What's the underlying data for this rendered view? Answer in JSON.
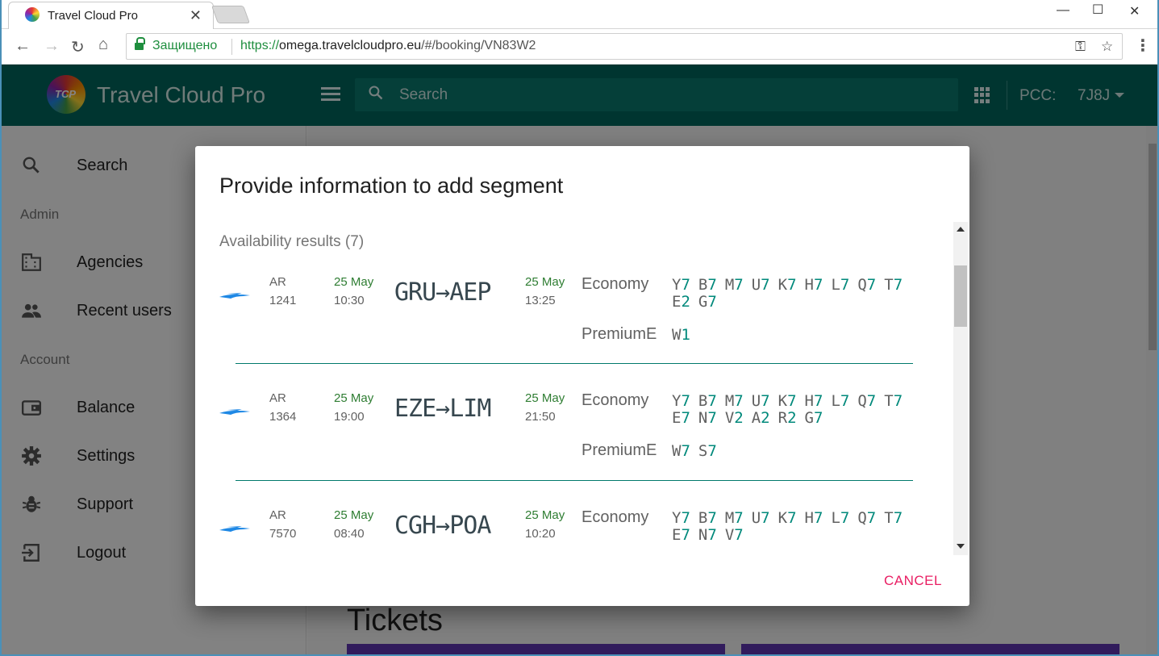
{
  "browser": {
    "tab_title": "Travel Cloud Pro",
    "secure_label": "Защищено",
    "url_scheme": "https://",
    "url_host": "omega.travelcloudpro.eu",
    "url_path": "/#/booking/VN83W2"
  },
  "appbar": {
    "brand": "Travel Cloud Pro",
    "logo_text": "TCP",
    "search_placeholder": "Search",
    "pcc_label": "PCC:",
    "pcc_value": "7J8J"
  },
  "sidebar": {
    "search": "Search",
    "admin_header": "Admin",
    "agencies": "Agencies",
    "recent_users": "Recent users",
    "account_header": "Account",
    "balance": "Balance",
    "settings": "Settings",
    "support": "Support",
    "logout": "Logout"
  },
  "main": {
    "tickets_heading": "Tickets"
  },
  "dialog": {
    "title": "Provide information to add segment",
    "results_heading": "Availability results (7)",
    "cancel_label": "CANCEL",
    "segments": [
      {
        "carrier": "AR",
        "flight": "1241",
        "dep_date": "25 May",
        "dep_time": "10:30",
        "route": "GRU→AEP",
        "arr_date": "25 May",
        "arr_time": "13:25",
        "cabins": [
          {
            "name": "Economy",
            "classes": [
              [
                "Y",
                "7"
              ],
              [
                "B",
                "7"
              ],
              [
                "M",
                "7"
              ],
              [
                "U",
                "7"
              ],
              [
                "K",
                "7"
              ],
              [
                "H",
                "7"
              ],
              [
                "L",
                "7"
              ],
              [
                "Q",
                "7"
              ],
              [
                "T",
                "7"
              ],
              [
                "E",
                "2"
              ],
              [
                "G",
                "7"
              ]
            ]
          },
          {
            "name": "PremiumE",
            "classes": [
              [
                "W",
                "1"
              ]
            ]
          }
        ]
      },
      {
        "carrier": "AR",
        "flight": "1364",
        "dep_date": "25 May",
        "dep_time": "19:00",
        "route": "EZE→LIM",
        "arr_date": "25 May",
        "arr_time": "21:50",
        "cabins": [
          {
            "name": "Economy",
            "classes": [
              [
                "Y",
                "7"
              ],
              [
                "B",
                "7"
              ],
              [
                "M",
                "7"
              ],
              [
                "U",
                "7"
              ],
              [
                "K",
                "7"
              ],
              [
                "H",
                "7"
              ],
              [
                "L",
                "7"
              ],
              [
                "Q",
                "7"
              ],
              [
                "T",
                "7"
              ],
              [
                "E",
                "7"
              ],
              [
                "N",
                "7"
              ],
              [
                "V",
                "2"
              ],
              [
                "A",
                "2"
              ],
              [
                "R",
                "2"
              ],
              [
                "G",
                "7"
              ]
            ]
          },
          {
            "name": "PremiumE",
            "classes": [
              [
                "W",
                "7"
              ],
              [
                "S",
                "7"
              ]
            ]
          }
        ]
      },
      {
        "carrier": "AR",
        "flight": "7570",
        "dep_date": "25 May",
        "dep_time": "08:40",
        "route": "CGH→POA",
        "arr_date": "25 May",
        "arr_time": "10:20",
        "cabins": [
          {
            "name": "Economy",
            "classes": [
              [
                "Y",
                "7"
              ],
              [
                "B",
                "7"
              ],
              [
                "M",
                "7"
              ],
              [
                "U",
                "7"
              ],
              [
                "K",
                "7"
              ],
              [
                "H",
                "7"
              ],
              [
                "L",
                "7"
              ],
              [
                "Q",
                "7"
              ],
              [
                "T",
                "7"
              ],
              [
                "E",
                "7"
              ],
              [
                "N",
                "7"
              ],
              [
                "V",
                "7"
              ]
            ]
          }
        ]
      }
    ]
  },
  "colors": {
    "appbar": "#00665c",
    "accent_green": "#2e7d32",
    "class_count": "#00897b",
    "cancel": "#e91e63"
  }
}
